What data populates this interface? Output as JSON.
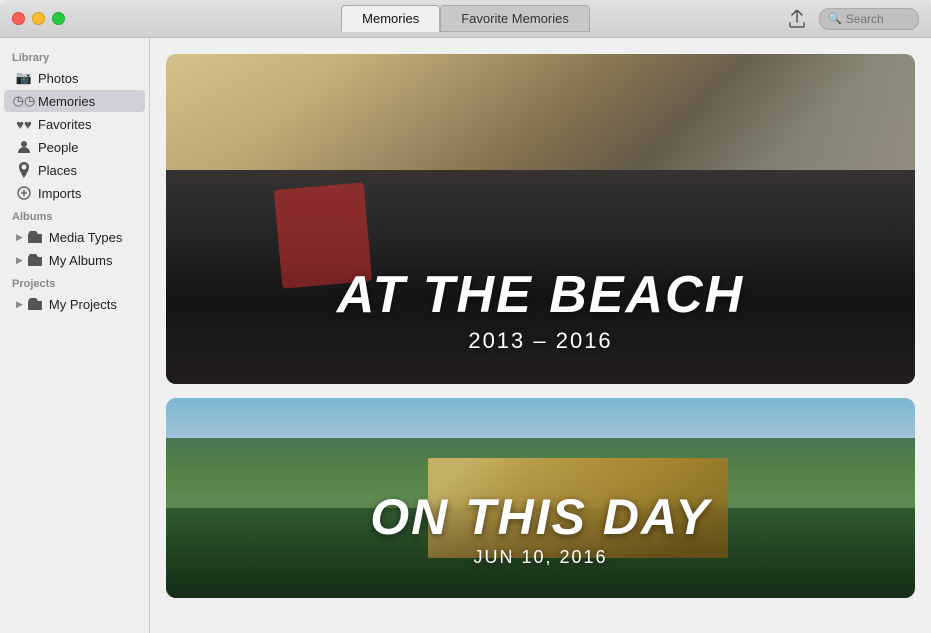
{
  "titleBar": {
    "tabs": [
      {
        "label": "Memories",
        "active": true
      },
      {
        "label": "Favorite Memories",
        "active": false
      }
    ],
    "shareButtonTitle": "Share",
    "search": {
      "placeholder": "Search"
    }
  },
  "sidebar": {
    "sections": [
      {
        "label": "Library",
        "items": [
          {
            "id": "photos",
            "label": "Photos",
            "icon": "photo-icon",
            "active": false
          },
          {
            "id": "memories",
            "label": "Memories",
            "icon": "memory-icon",
            "active": true
          },
          {
            "id": "favorites",
            "label": "Favorites",
            "icon": "heart-icon",
            "active": false
          },
          {
            "id": "people",
            "label": "People",
            "icon": "person-icon",
            "active": false
          },
          {
            "id": "places",
            "label": "Places",
            "icon": "pin-icon",
            "active": false
          },
          {
            "id": "imports",
            "label": "Imports",
            "icon": "import-icon",
            "active": false
          }
        ]
      },
      {
        "label": "Albums",
        "items": [
          {
            "id": "media-types",
            "label": "Media Types",
            "icon": "folder-icon",
            "active": false,
            "expandable": true
          },
          {
            "id": "my-albums",
            "label": "My Albums",
            "icon": "folder-icon",
            "active": false,
            "expandable": true
          }
        ]
      },
      {
        "label": "Projects",
        "items": [
          {
            "id": "my-projects",
            "label": "My Projects",
            "icon": "folder-icon",
            "active": false,
            "expandable": true
          }
        ]
      }
    ]
  },
  "memories": [
    {
      "id": "beach",
      "title": "AT THE BEACH",
      "subtitle": "2013 – 2016",
      "bgClass": "beach-bg"
    },
    {
      "id": "on-this-day",
      "title": "ON THIS DAY",
      "subtitle": "JUN 10, 2016",
      "bgClass": "outdoor-bg"
    }
  ]
}
